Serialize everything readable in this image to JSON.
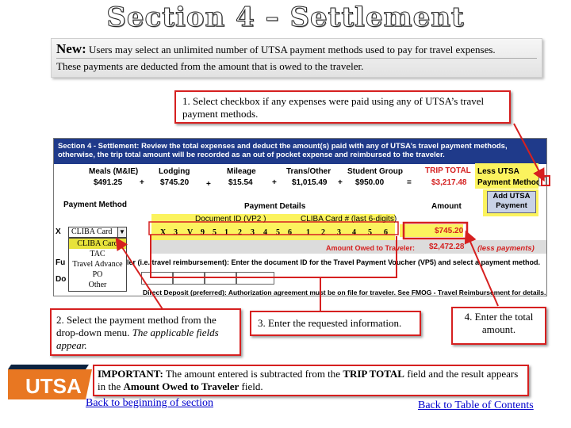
{
  "title": "Section 4 – Settlement",
  "intro": {
    "new_label": "New:",
    "line1": "Users may select an unlimited number of UTSA payment methods used to pay for travel expenses.",
    "line2": "These payments are deducted from the amount that is owed to the traveler."
  },
  "callouts": {
    "step1": "1. Select checkbox if any expenses were paid using any of UTSA’s travel payment methods.",
    "step2_plain": "2. Select the payment method from the drop-down menu.",
    "step2_italic": "The applicable fields appear.",
    "step3": "3. Enter the requested information.",
    "step4": "4. Enter the total amount.",
    "important_label": "IMPORTANT:",
    "important_text1": "The amount entered is subtracted from the",
    "important_bold1": "TRIP TOTAL",
    "important_text2": "field and the result appears in the",
    "important_bold2": "Amount Owed to Traveler",
    "important_text3": "field."
  },
  "form": {
    "header_bold": "Section 4 - Settlement:",
    "header_text": "Review the total expenses and deduct the amount(s) paid with any of UTSA’s travel payment methods, otherwise, the trip total amount will be recorded as an out of pocket expense and reimbursed to the traveler.",
    "columns": [
      "Meals (M&IE)",
      "Lodging",
      "Mileage",
      "Trans/Other",
      "Student Group",
      "TRIP TOTAL",
      "Less UTSA"
    ],
    "values": [
      "$491.25",
      "$745.20",
      "$15.54",
      "$1,015.49",
      "$950.00",
      "$3,217.48"
    ],
    "operators": [
      "+",
      "+",
      "+",
      "+",
      "="
    ],
    "payment_method_label": "Payment Method",
    "add_utsa_label": "Add UTSA Payment",
    "payment_method_col": "Payment Method",
    "payment_details_col": "Payment Details",
    "amount_col": "Amount",
    "doc_id_label": "Document ID (VP2 )",
    "cliba_label": "CLIBA Card # (last 6-digits)",
    "doc_digits": [
      "X",
      "3",
      "V",
      "9",
      "5",
      "1",
      "2",
      "3",
      "4",
      "5",
      "6"
    ],
    "cliba_digits": [
      "1",
      "2",
      "3",
      "4",
      "5",
      "6"
    ],
    "x_mark": "X",
    "amount_value": "$745.20",
    "amount_owed_label": "Amount Owed to Traveler:",
    "amount_owed_value": "$2,472.28",
    "less_payments": "(less payments)",
    "funding_text": "ler (i.e. travel reimbursement): Enter the document ID for the Travel Payment Voucher (VP5) and select a payment method.",
    "fu_prefix": "Fu",
    "do_prefix": "Do",
    "direct_deposit": "Direct Deposit (preferred): Authorization agreement must be on file for traveler. See FMOG - Travel Reimbursement for details.",
    "dropdown_value": "CLIBA Card",
    "dropdown_options": [
      "CLIBA Card",
      "TAC",
      "Travel Advance",
      "PO",
      "Other"
    ]
  },
  "links": {
    "back_section": "Back to beginning of section",
    "back_toc": "Back to Table of Contents"
  },
  "logo_text": "UTSA",
  "colors": {
    "callout_border": "#d62020",
    "header_blue": "#1f3a8a",
    "highlight_yellow": "#fbf35e",
    "link_blue": "#0000cc",
    "logo_orange": "#e87722"
  }
}
